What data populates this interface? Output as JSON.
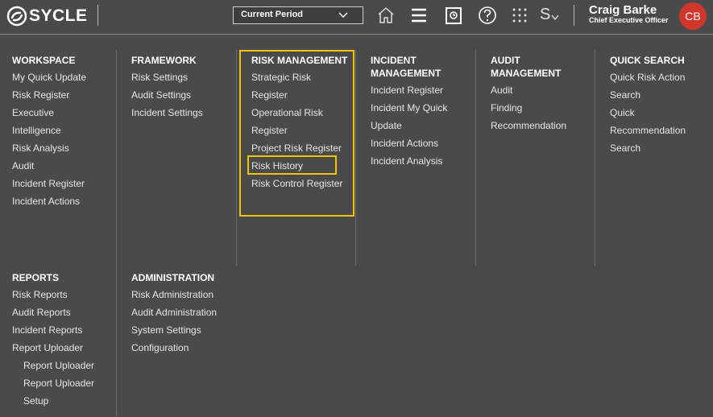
{
  "header": {
    "logo_text": "SYCLE",
    "period_label": "Current Period",
    "user_name": "Craig Barke",
    "user_role": "Chief Executive Officer",
    "avatar_initials": "CB",
    "s_menu_label": "S",
    "icons": [
      "home-icon",
      "hamburger-menu-icon",
      "clipboard-icon",
      "help-icon",
      "apps-grid-icon",
      "chevron-down-icon"
    ],
    "accent_color": "#d0362b",
    "highlight_color": "#f5c400"
  },
  "menu": {
    "workspace": {
      "title": "WORKSPACE",
      "items": [
        "My Quick Update",
        "Risk Register",
        "Executive",
        "Intelligence",
        "Risk Analysis",
        "Audit",
        "Incident Register",
        "Incident Actions"
      ]
    },
    "framework": {
      "title": "FRAMEWORK",
      "items": [
        "Risk Settings",
        "Audit Settings",
        "Incident Settings"
      ]
    },
    "risk_management": {
      "title": "RISK MANAGEMENT",
      "items": [
        "Strategic Risk",
        "Register",
        "Operational Risk",
        "Register",
        "Project Risk Register",
        "Risk History",
        "Risk Control Register"
      ]
    },
    "incident_management": {
      "title_line1": "INCIDENT",
      "title_line2": "MANAGEMENT",
      "items": [
        "Incident Register",
        "Incident My Quick",
        "Update",
        "Incident Actions",
        "Incident Analysis"
      ]
    },
    "audit_management": {
      "title_line1": "AUDIT",
      "title_line2": "MANAGEMENT",
      "items": [
        "Audit",
        "Finding",
        "Recommendation"
      ]
    },
    "quick_search": {
      "title": "QUICK SEARCH",
      "items": [
        "Quick Risk Action",
        "Search",
        "Quick",
        "Recommendation",
        "Search"
      ]
    },
    "reports": {
      "title": "REPORTS",
      "items": [
        "Risk Reports",
        "Audit Reports",
        "Incident Reports",
        "Report Uploader"
      ],
      "sub_items": [
        "Report Uploader",
        "Report Uploader",
        "Setup"
      ]
    },
    "administration": {
      "title": "ADMINISTRATION",
      "items": [
        "Risk Administration",
        "Audit Administration",
        "System Settings",
        "Configuration"
      ]
    }
  }
}
